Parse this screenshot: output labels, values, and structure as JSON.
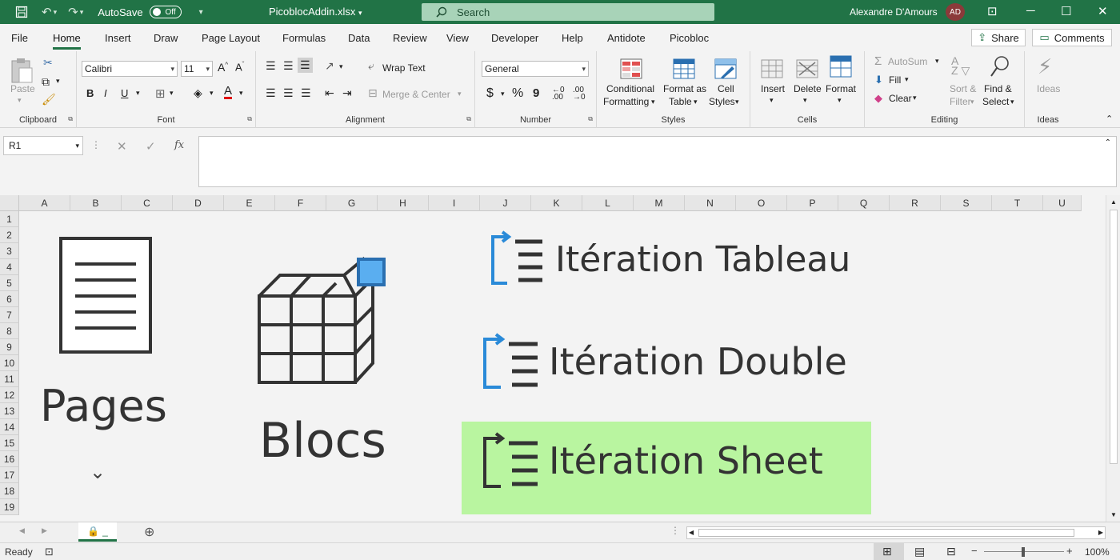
{
  "titlebar": {
    "autosave_label": "AutoSave",
    "autosave_state": "Off",
    "filename": "PicoblocAddin.xlsx",
    "search_placeholder": "Search",
    "user_name": "Alexandre D'Amours",
    "user_initials": "AD",
    "bg_color": "#217346"
  },
  "tabs": [
    "File",
    "Home",
    "Insert",
    "Draw",
    "Page Layout",
    "Formulas",
    "Data",
    "Review",
    "View",
    "Developer",
    "Help",
    "Antidote",
    "Picobloc"
  ],
  "active_tab": "Home",
  "share_label": "Share",
  "comments_label": "Comments",
  "ribbon": {
    "clipboard": {
      "label": "Clipboard",
      "paste": "Paste"
    },
    "font": {
      "label": "Font",
      "family": "Calibri",
      "size": "11",
      "bold": "B",
      "italic": "I",
      "underline": "U"
    },
    "alignment": {
      "label": "Alignment",
      "wrap_text": "Wrap Text",
      "merge_center": "Merge & Center"
    },
    "number": {
      "label": "Number",
      "format": "General",
      "currency": "$",
      "percent": "%",
      "comma": "9"
    },
    "styles": {
      "label": "Styles",
      "conditional_1": "Conditional",
      "conditional_2": "Formatting",
      "format_table_1": "Format as",
      "format_table_2": "Table",
      "cell_styles_1": "Cell",
      "cell_styles_2": "Styles"
    },
    "cells": {
      "label": "Cells",
      "insert": "Insert",
      "delete": "Delete",
      "format": "Format"
    },
    "editing": {
      "label": "Editing",
      "autosum": "AutoSum",
      "fill": "Fill",
      "clear": "Clear",
      "sort_1": "Sort &",
      "sort_2": "Filter",
      "find_1": "Find &",
      "find_2": "Select"
    },
    "ideas": {
      "label": "Ideas",
      "ideas": "Ideas"
    }
  },
  "formula_bar": {
    "name_box": "R1",
    "fx": "fx",
    "content": ""
  },
  "columns": [
    "A",
    "B",
    "C",
    "D",
    "E",
    "F",
    "G",
    "H",
    "I",
    "J",
    "K",
    "L",
    "M",
    "N",
    "O",
    "P",
    "Q",
    "R",
    "S",
    "T",
    "U"
  ],
  "rows": [
    "1",
    "2",
    "3",
    "4",
    "5",
    "6",
    "7",
    "8",
    "9",
    "10",
    "11",
    "12",
    "13",
    "14",
    "15",
    "16",
    "17",
    "18",
    "19"
  ],
  "sheet_content": {
    "pages_label": "Pages",
    "blocs_label": "Blocs",
    "iteration_tableau": "Itération Tableau",
    "iteration_double": "Itération Double",
    "iteration_sheet": "Itération Sheet",
    "highlight_color": "#b9f5a0",
    "accent_blue": "#2a8ad8"
  },
  "sheet_tab": {
    "name": "_"
  },
  "status": {
    "ready": "Ready",
    "zoom": "100%"
  }
}
